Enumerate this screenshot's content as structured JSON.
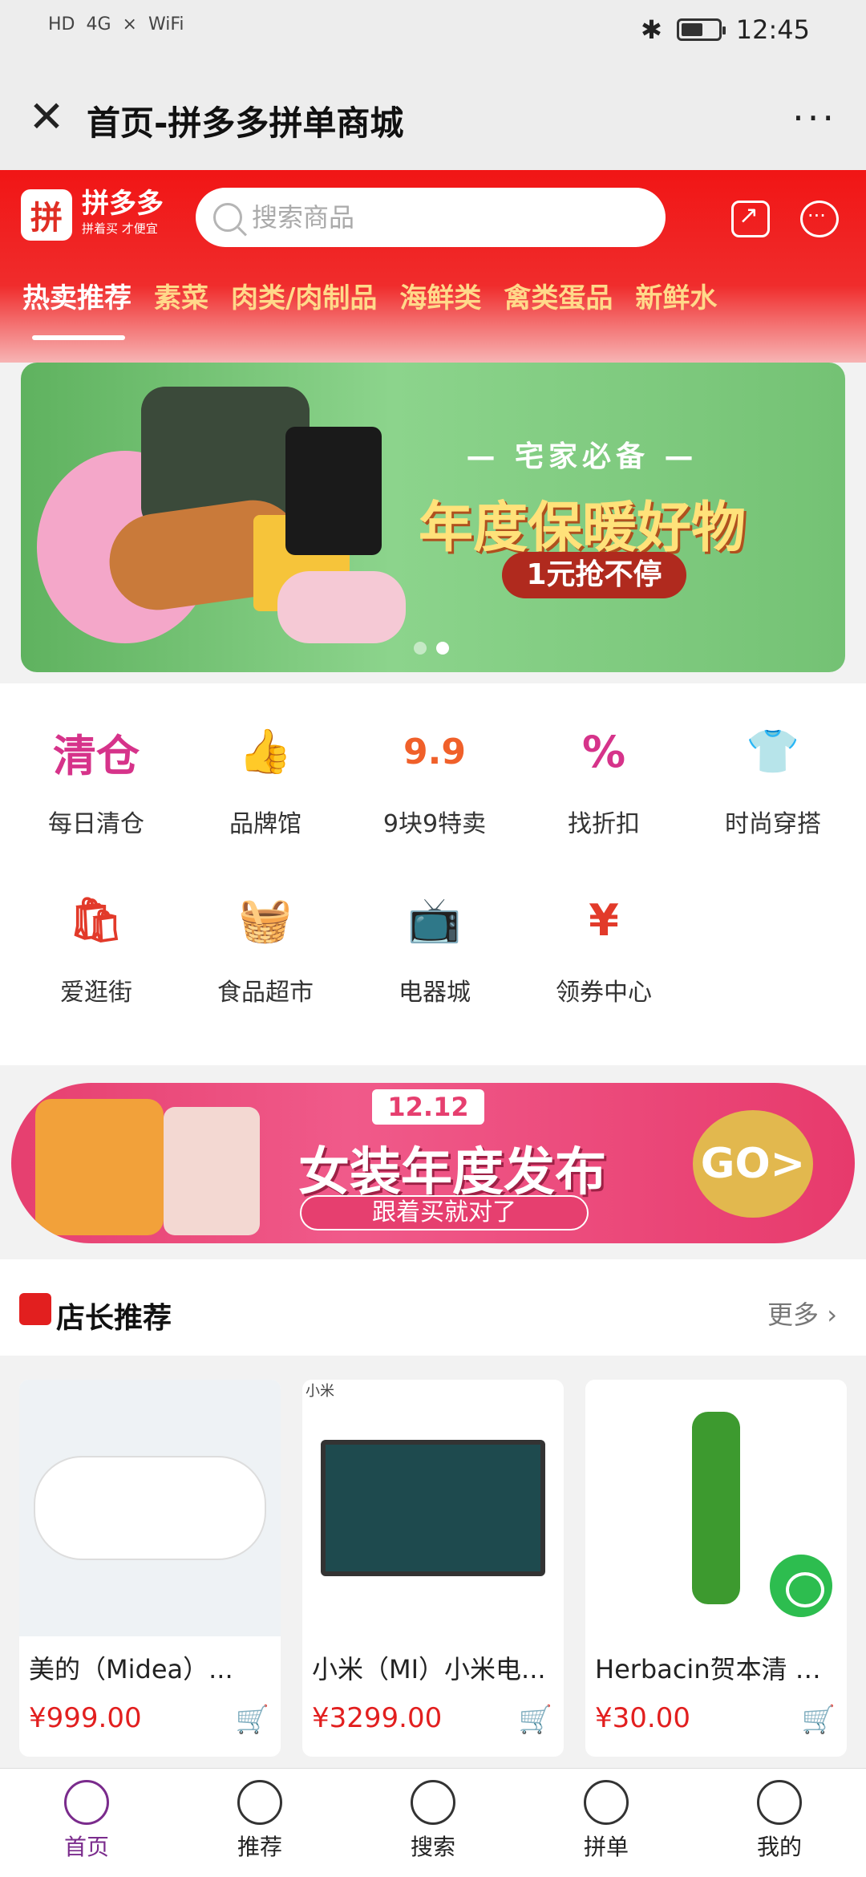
{
  "status_bar": {
    "left": [
      "HD",
      "4G",
      "×",
      "WiFi"
    ],
    "time": "12:45"
  },
  "title_bar": {
    "close_icon": "close-icon",
    "title": "首页-拼多多拼单商城",
    "more": "···"
  },
  "header": {
    "logo_char": "拼",
    "logo_text": "拼多多",
    "logo_slogan": "拼着买 才便宜",
    "search_placeholder": "搜索商品",
    "share_icon": "share-icon",
    "chat_icon": "chat-icon"
  },
  "tabs": [
    "热卖推荐",
    "素菜",
    "肉类/肉制品",
    "海鲜类",
    "禽类蛋品",
    "新鲜水"
  ],
  "banner": {
    "subtitle": "— 宅家必备 —",
    "title": "年度保暖好物",
    "cta": "1元抢不停",
    "carousel_dots": 2,
    "active_dot": 1
  },
  "quick_links": [
    {
      "label": "每日清仓",
      "icon": "clearance-icon",
      "glyph": "清仓",
      "color": "#d6338a"
    },
    {
      "label": "品牌馆",
      "icon": "brand-icon",
      "glyph": "👍",
      "color": "#e23a2a"
    },
    {
      "label": "9块9特卖",
      "icon": "99-sale-icon",
      "glyph": "9.9",
      "color": "#f0602a"
    },
    {
      "label": "找折扣",
      "icon": "discount-tag-icon",
      "glyph": "%",
      "color": "#d6338a"
    },
    {
      "label": "时尚穿搭",
      "icon": "tshirt-icon",
      "glyph": "👕",
      "color": "#e05a6a"
    },
    {
      "label": "爱逛街",
      "icon": "shopping-bag-icon",
      "glyph": "🛍",
      "color": "#e23a2a"
    },
    {
      "label": "食品超市",
      "icon": "food-basket-icon",
      "glyph": "🧺",
      "color": "#2fb35a"
    },
    {
      "label": "电器城",
      "icon": "tv-icon",
      "glyph": "📺",
      "color": "#1b6ab8"
    },
    {
      "label": "领券中心",
      "icon": "coupon-icon",
      "glyph": "¥",
      "color": "#e23a2a"
    }
  ],
  "promo": {
    "date": "12.12",
    "title": "女装年度发布",
    "subtitle": "跟着买就对了",
    "go": "GO>"
  },
  "section": {
    "title": "店长推荐",
    "more": "更多"
  },
  "products": [
    {
      "brand": "",
      "name": "美的（Midea）...",
      "price": "¥999.00",
      "image": "water-heater-image",
      "color": "#e8eef3"
    },
    {
      "brand": "小米",
      "name": "小米（MI）小米电...",
      "price": "¥3299.00",
      "image": "tv-image",
      "color": "#1e4a4e"
    },
    {
      "brand": "",
      "name": "Herbacin贺本清 小...",
      "price": "¥30.00",
      "image": "lip-balm-image",
      "color": "#ffffff"
    }
  ],
  "bottom_nav": [
    {
      "label": "首页",
      "icon": "home-icon",
      "active": true
    },
    {
      "label": "推荐",
      "icon": "list-icon",
      "active": false
    },
    {
      "label": "搜索",
      "icon": "compass-icon",
      "active": false
    },
    {
      "label": "拼单",
      "icon": "group-buy-icon",
      "active": false
    },
    {
      "label": "我的",
      "icon": "user-icon",
      "active": false
    }
  ]
}
